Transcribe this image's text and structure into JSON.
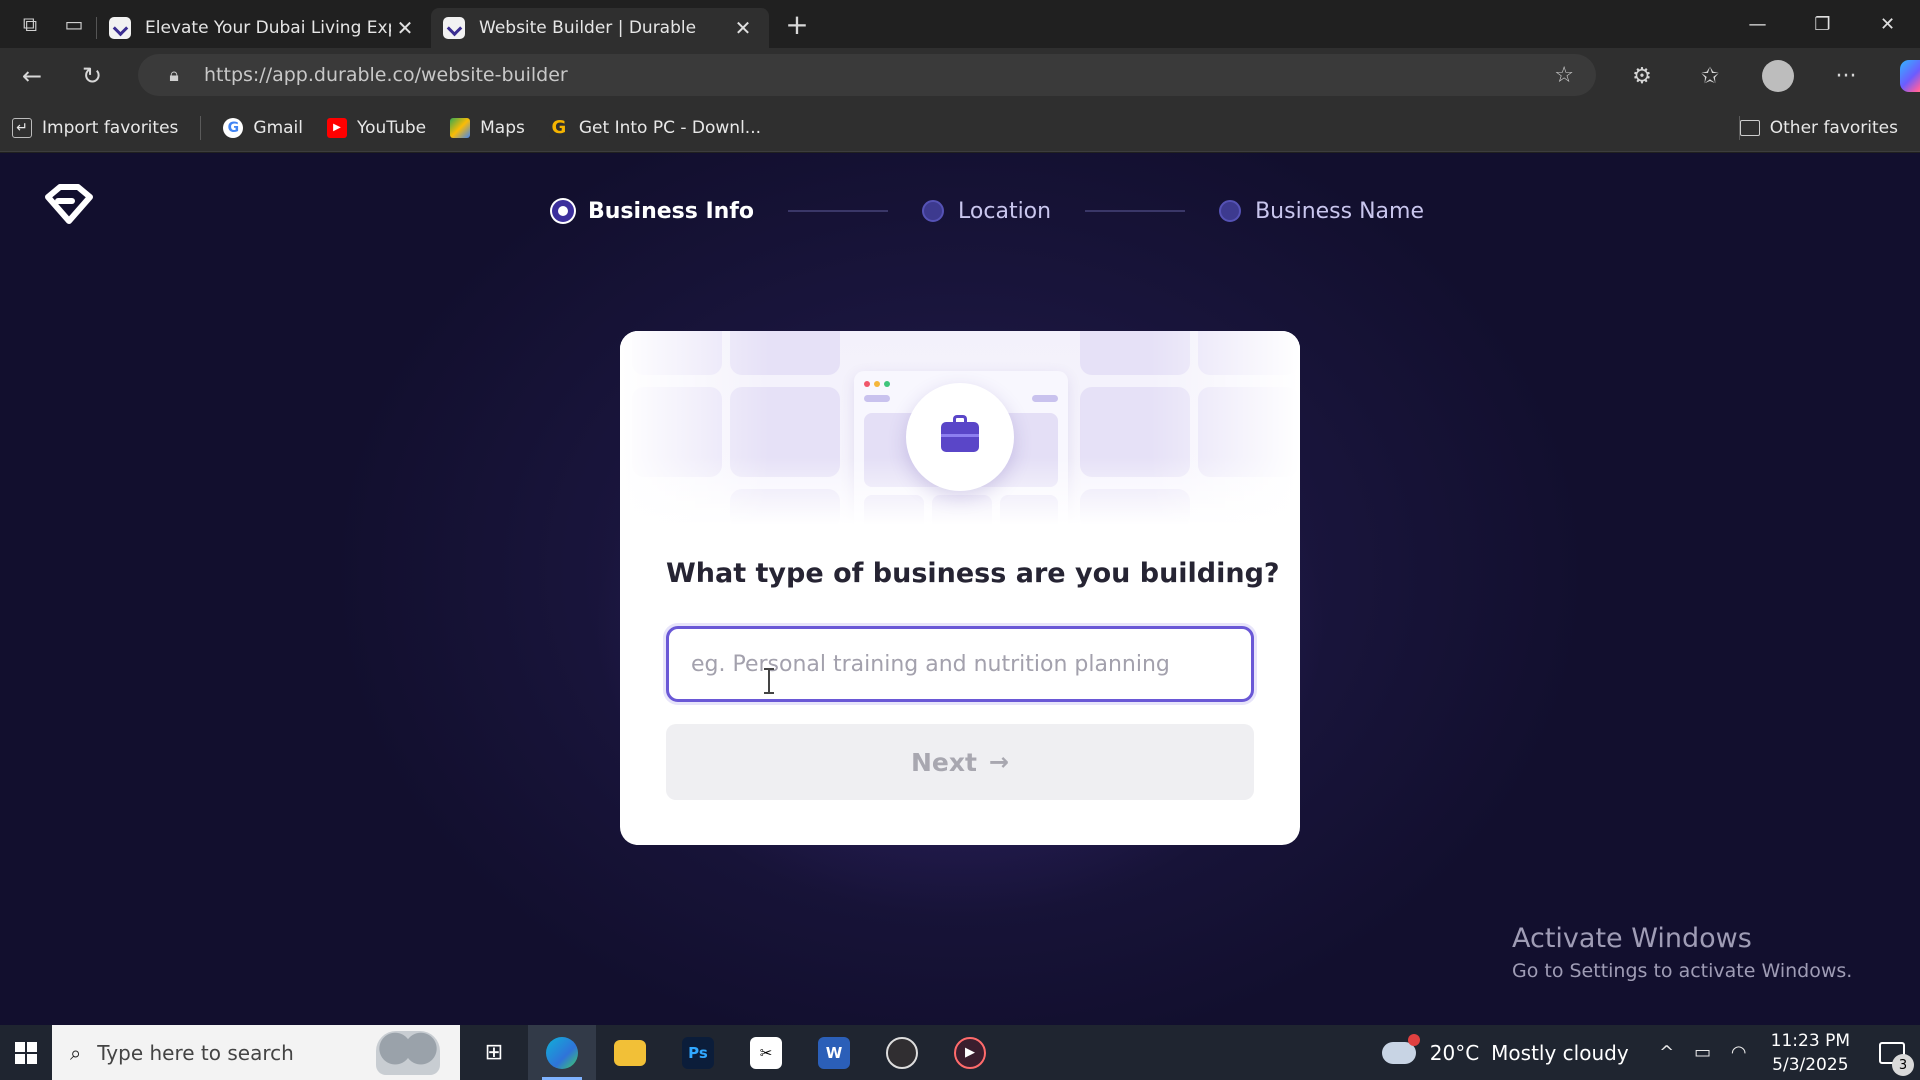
{
  "browser": {
    "tabs": [
      {
        "title": "Elevate Your Dubai Living Experie",
        "active": false
      },
      {
        "title": "Website Builder | Durable",
        "active": true
      }
    ],
    "url_domain": "https://app.durable.co",
    "url_path": "/website-builder",
    "bookmarks": [
      "Import favorites",
      "Gmail",
      "YouTube",
      "Maps",
      "Get Into PC - Downl..."
    ],
    "other_favorites": "Other favorites"
  },
  "steps": [
    {
      "label": "Business Info",
      "state": "active"
    },
    {
      "label": "Location",
      "state": "pending"
    },
    {
      "label": "Business Name",
      "state": "pending"
    }
  ],
  "card": {
    "question": "What type of business are you building?",
    "input_placeholder": "eg. Personal training and nutrition planning",
    "input_value": "",
    "next_label": "Next",
    "next_arrow": "→"
  },
  "watermark": {
    "line1": "Activate Windows",
    "line2": "Go to Settings to activate Windows."
  },
  "taskbar": {
    "search_placeholder": "Type here to search",
    "weather_temp": "20°C",
    "weather_desc": "Mostly cloudy",
    "time": "11:23 PM",
    "date": "5/3/2025",
    "notification_count": "3"
  },
  "colors": {
    "accent": "#6a58d6",
    "page_bg": "#141133",
    "briefcase": "#5a46c8"
  }
}
